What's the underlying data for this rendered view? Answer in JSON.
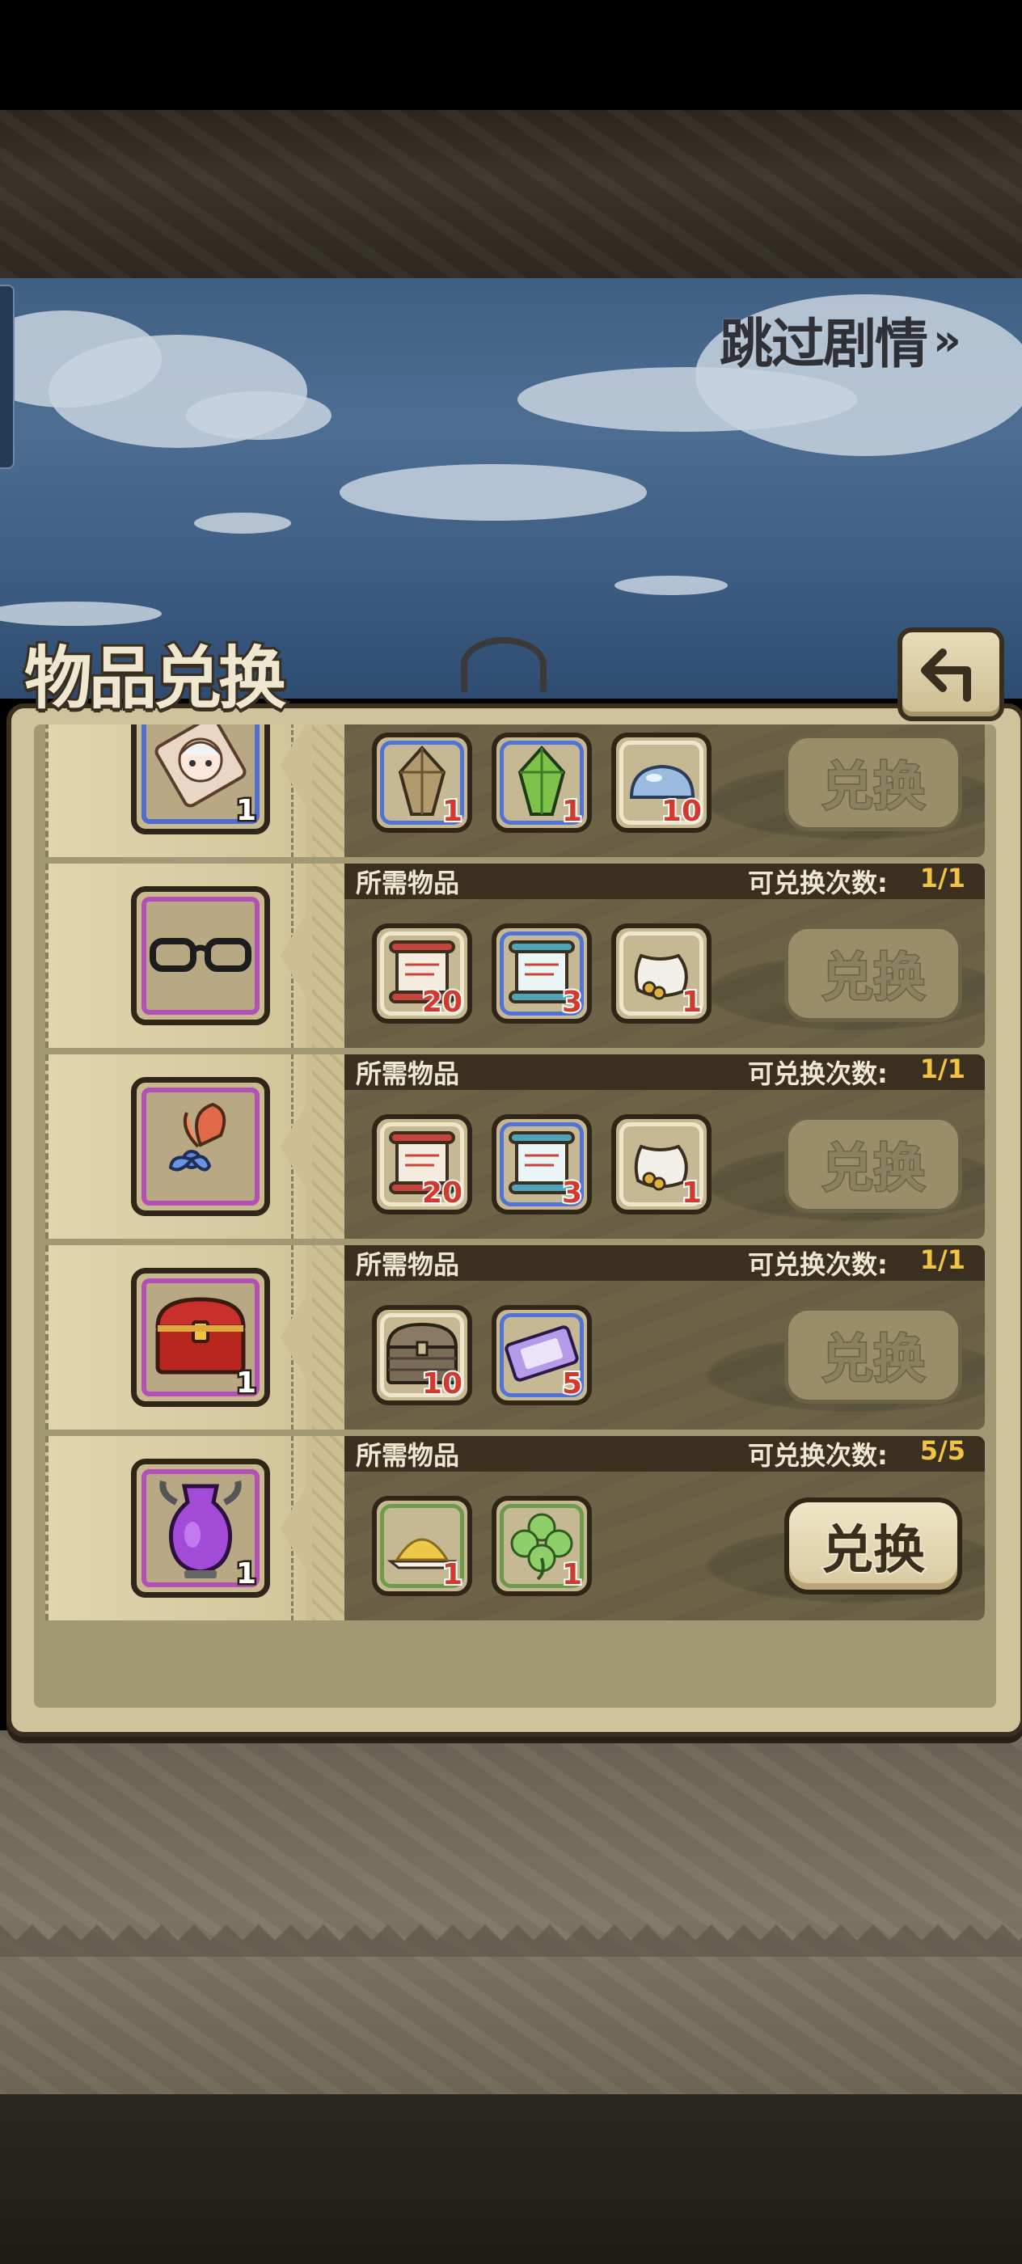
{
  "skip_story_label": "跳过剧情",
  "skip_story_chevron": "»",
  "panel_title": "物品兑换",
  "back_icon": "back-arrow-icon",
  "colors": {
    "accent_yellow": "#f0c343",
    "frame_purple": "#b44fb8",
    "frame_blue": "#4f6cd4",
    "frame_green": "#6d9b4b"
  },
  "exchange_rows": [
    {
      "reward_icon": "chibi-portrait-icon",
      "reward_qty": "1",
      "reward_frame": "blue",
      "required_label": "",
      "count_label": "",
      "count_value": "",
      "required": [
        {
          "icon": "amber-crystal-icon",
          "count": "1",
          "frame": "blue"
        },
        {
          "icon": "green-crystal-icon",
          "count": "1",
          "frame": "blue"
        },
        {
          "icon": "blue-slime-icon",
          "count": "10",
          "frame": "white"
        }
      ],
      "button_label": "兑换",
      "button_enabled": false
    },
    {
      "reward_icon": "glasses-icon",
      "reward_qty": "",
      "reward_frame": "purple",
      "required_label": "所需物品",
      "count_label": "可兑换次数:",
      "count_value": "1/1",
      "required": [
        {
          "icon": "red-scroll-icon",
          "count": "20",
          "frame": "white"
        },
        {
          "icon": "blue-scroll-icon",
          "count": "3",
          "frame": "blue"
        },
        {
          "icon": "coin-sack-icon",
          "count": "1",
          "frame": "white"
        }
      ],
      "button_label": "兑换",
      "button_enabled": false
    },
    {
      "reward_icon": "flower-ribbon-icon",
      "reward_qty": "",
      "reward_frame": "purple",
      "required_label": "所需物品",
      "count_label": "可兑换次数:",
      "count_value": "1/1",
      "required": [
        {
          "icon": "red-scroll-icon",
          "count": "20",
          "frame": "white"
        },
        {
          "icon": "blue-scroll-icon",
          "count": "3",
          "frame": "blue"
        },
        {
          "icon": "coin-sack-icon",
          "count": "1",
          "frame": "white"
        }
      ],
      "button_label": "兑换",
      "button_enabled": false
    },
    {
      "reward_icon": "red-treasure-chest-icon",
      "reward_qty": "1",
      "reward_frame": "purple",
      "required_label": "所需物品",
      "count_label": "可兑换次数:",
      "count_value": "1/1",
      "required": [
        {
          "icon": "wooden-chest-icon",
          "count": "10",
          "frame": "white"
        },
        {
          "icon": "purple-ticket-icon",
          "count": "5",
          "frame": "blue"
        }
      ],
      "button_label": "兑换",
      "button_enabled": false
    },
    {
      "reward_icon": "purple-vase-icon",
      "reward_qty": "1",
      "reward_frame": "purple",
      "required_label": "所需物品",
      "count_label": "可兑换次数:",
      "count_value": "5/5",
      "required": [
        {
          "icon": "gold-powder-icon",
          "count": "1",
          "frame": "green"
        },
        {
          "icon": "clover-icon",
          "count": "1",
          "frame": "green"
        }
      ],
      "button_label": "兑换",
      "button_enabled": true
    }
  ]
}
